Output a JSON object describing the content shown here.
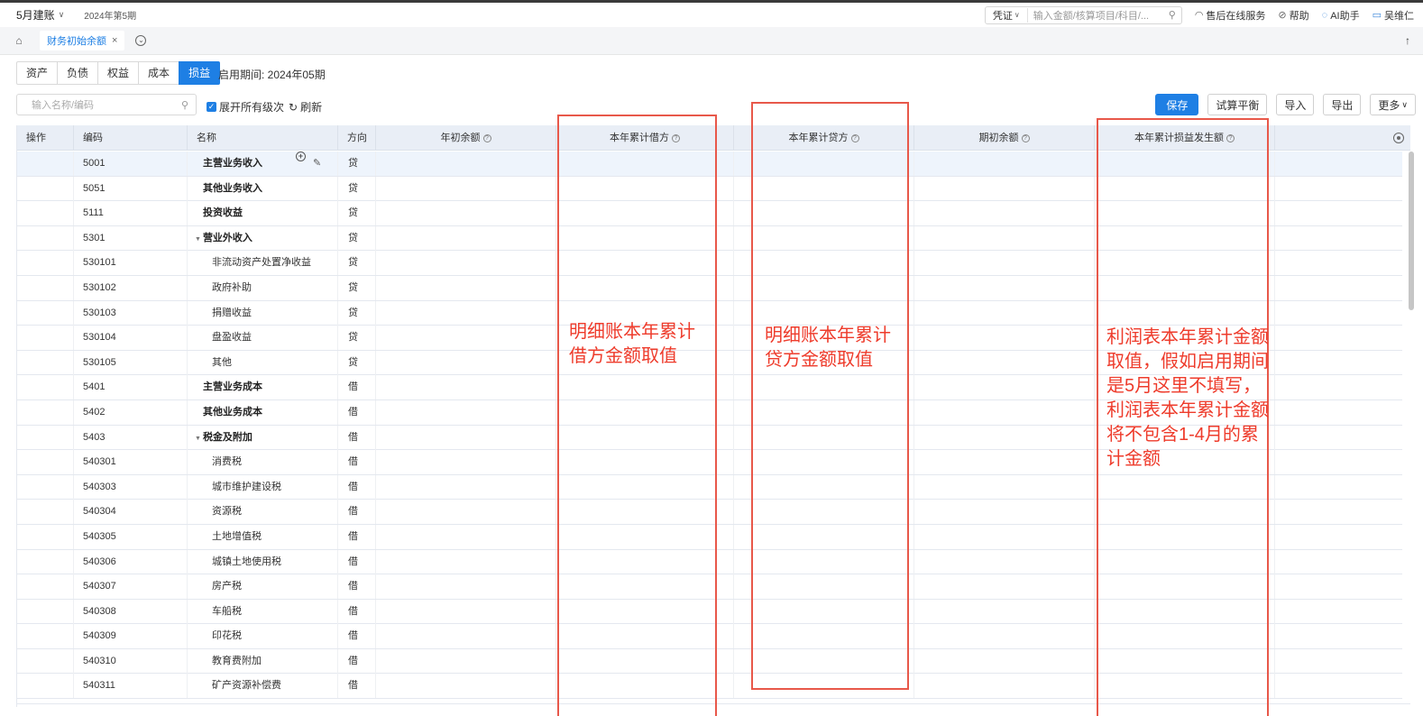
{
  "topbar": {
    "account": "5月建账",
    "period": "2024年第5期",
    "voucher_select": "凭证",
    "search_placeholder": "输入金额/核算项目/科目/...",
    "service": "售后在线服务",
    "help": "帮助",
    "ai": "AI助手",
    "user": "吴维仁"
  },
  "tabbar": {
    "tab_label": "财务初始余额"
  },
  "segments": [
    "资产",
    "负债",
    "权益",
    "成本",
    "损益"
  ],
  "active_segment": "损益",
  "start_period": "启用期间: 2024年05期",
  "toolbar": {
    "filter_placeholder": "输入名称/编码",
    "expand_all": "展开所有级次",
    "refresh": "刷新",
    "save": "保存",
    "trial_balance": "试算平衡",
    "import": "导入",
    "export": "导出",
    "more": "更多"
  },
  "columns": {
    "action": "操作",
    "code": "编码",
    "name": "名称",
    "direction": "方向",
    "opening_year": "年初余额",
    "ytd_debit": "本年累计借方",
    "ytd_credit": "本年累计贷方",
    "opening_period": "期初余额",
    "ytd_pl": "本年累计损益发生额"
  },
  "rows": [
    {
      "code": "5001",
      "name": "主营业务收入",
      "dir": "贷",
      "bold": true
    },
    {
      "code": "5051",
      "name": "其他业务收入",
      "dir": "贷",
      "bold": true
    },
    {
      "code": "5111",
      "name": "投资收益",
      "dir": "贷",
      "bold": true
    },
    {
      "code": "5301",
      "name": "营业外收入",
      "dir": "贷",
      "bold": true
    },
    {
      "code": "530101",
      "name": "非流动资产处置净收益",
      "dir": "贷",
      "bold": false
    },
    {
      "code": "530102",
      "name": "政府补助",
      "dir": "贷",
      "bold": false
    },
    {
      "code": "530103",
      "name": "捐赠收益",
      "dir": "贷",
      "bold": false
    },
    {
      "code": "530104",
      "name": "盘盈收益",
      "dir": "贷",
      "bold": false
    },
    {
      "code": "530105",
      "name": "其他",
      "dir": "贷",
      "bold": false
    },
    {
      "code": "5401",
      "name": "主营业务成本",
      "dir": "借",
      "bold": true
    },
    {
      "code": "5402",
      "name": "其他业务成本",
      "dir": "借",
      "bold": true
    },
    {
      "code": "5403",
      "name": "税金及附加",
      "dir": "借",
      "bold": true
    },
    {
      "code": "540301",
      "name": "消费税",
      "dir": "借",
      "bold": false
    },
    {
      "code": "540303",
      "name": "城市维护建设税",
      "dir": "借",
      "bold": false
    },
    {
      "code": "540304",
      "name": "资源税",
      "dir": "借",
      "bold": false
    },
    {
      "code": "540305",
      "name": "土地增值税",
      "dir": "借",
      "bold": false
    },
    {
      "code": "540306",
      "name": "城镇土地使用税",
      "dir": "借",
      "bold": false
    },
    {
      "code": "540307",
      "name": "房产税",
      "dir": "借",
      "bold": false
    },
    {
      "code": "540308",
      "name": "车船税",
      "dir": "借",
      "bold": false
    },
    {
      "code": "540309",
      "name": "印花税",
      "dir": "借",
      "bold": false
    },
    {
      "code": "540310",
      "name": "教育费附加",
      "dir": "借",
      "bold": false
    },
    {
      "code": "540311",
      "name": "矿产资源补偿费",
      "dir": "借",
      "bold": false
    }
  ],
  "annotations": {
    "debit_note": "明细账本年累计借方金额取值",
    "credit_note": "明细账本年累计贷方金额取值",
    "pl_note": "利润表本年累计金额取值，假如启用期间是5月这里不填写，利润表本年累计金额将不包含1-4月的累计金额",
    "color": "#ee3b2b"
  },
  "colors": {
    "accent": "#1e7fe4",
    "header_bg": "#e9eef6"
  }
}
